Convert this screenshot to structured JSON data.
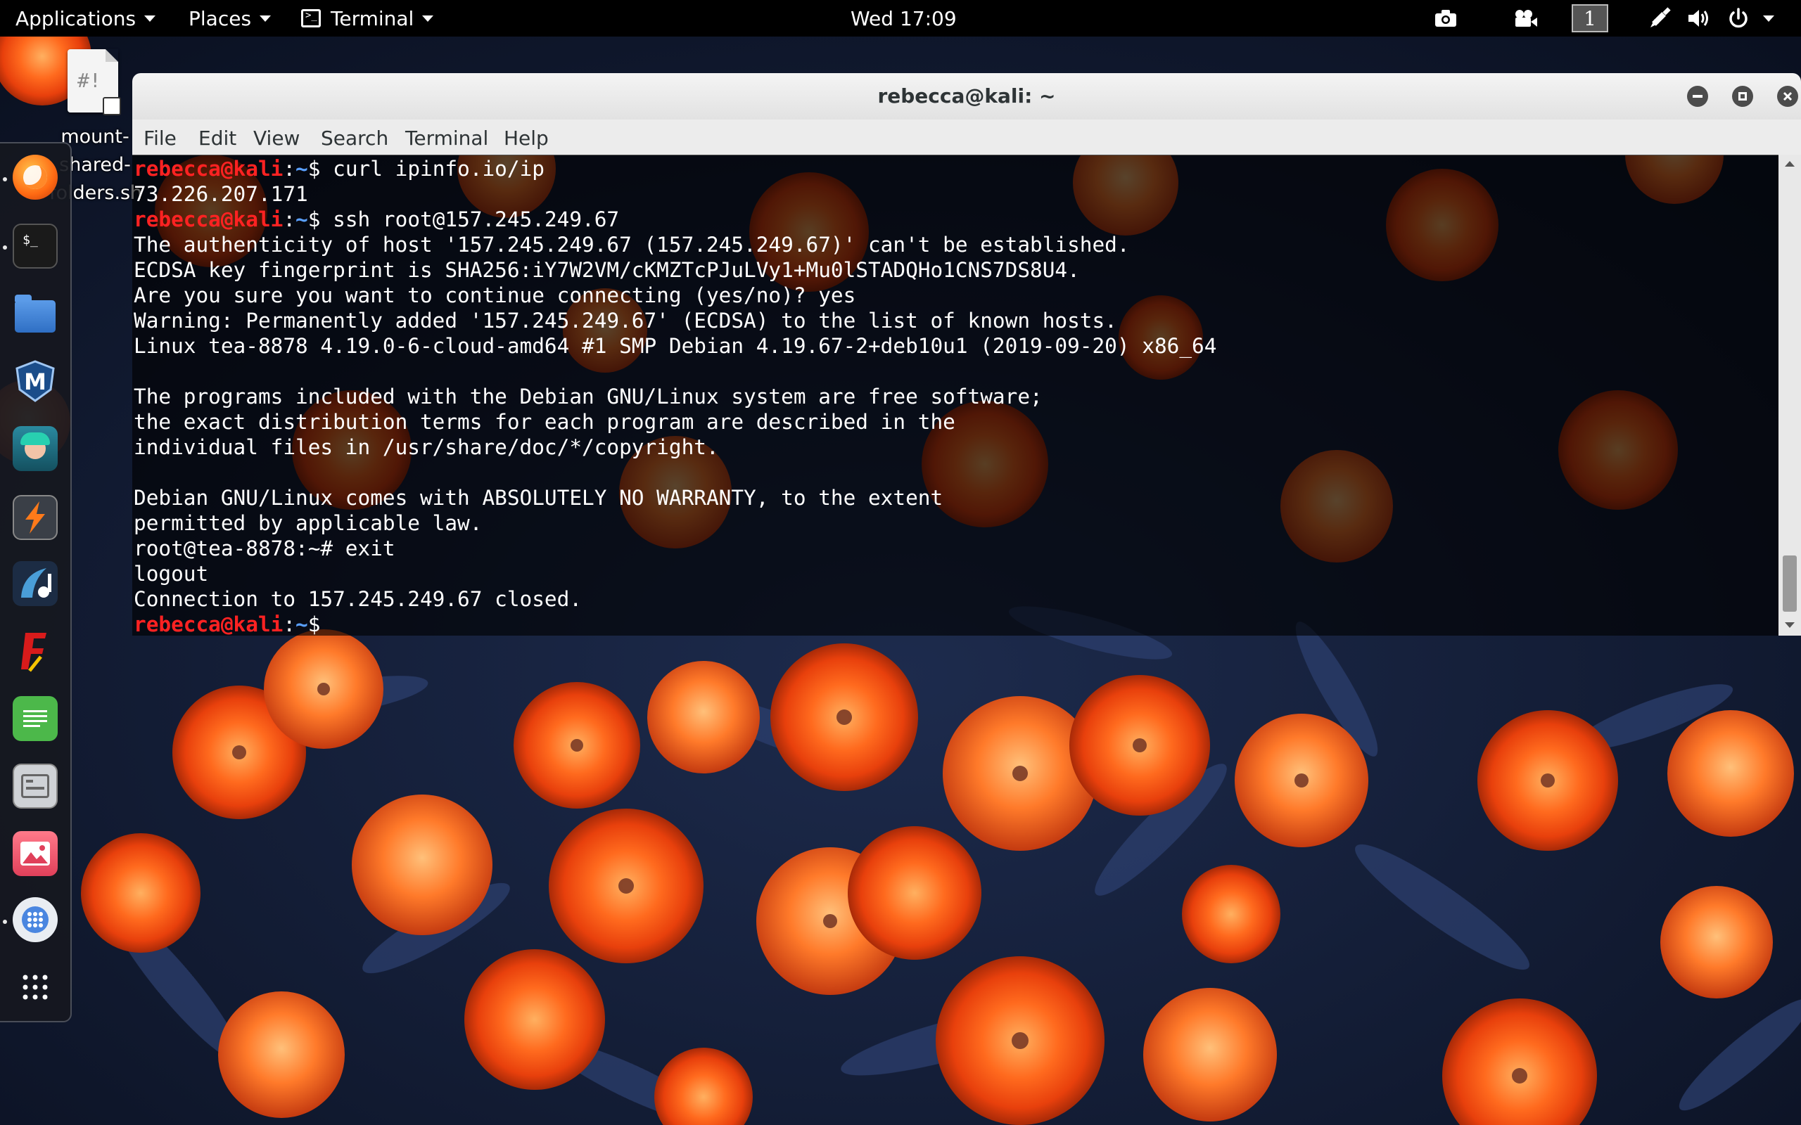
{
  "topbar": {
    "applications": "Applications",
    "places": "Places",
    "terminal_app": "Terminal",
    "clock": "Wed 17:09",
    "workspace": "1",
    "icons": [
      "camera-icon",
      "video-icon",
      "workspace-indicator",
      "pen-icon",
      "volume-icon",
      "power-icon"
    ]
  },
  "desktop": {
    "file_label": "mount-\nshared-\nfolders.sh",
    "file_icon_text": "#!"
  },
  "dock": {
    "items": [
      "firefox-icon",
      "terminal-icon",
      "files-icon",
      "metasploit-icon",
      "armitage-icon",
      "burpsuite-icon",
      "maltego-icon",
      "faraday-icon",
      "text-editor-icon",
      "settings-icon",
      "image-viewer-icon",
      "software-icon",
      "show-applications-icon"
    ]
  },
  "window": {
    "title": "rebecca@kali: ~",
    "menu": [
      "File",
      "Edit",
      "View",
      "Search",
      "Terminal",
      "Help"
    ]
  },
  "terminal": {
    "prompt_user": "rebecca@kali",
    "prompt_path": "~",
    "prompt_sym": "$",
    "lines": [
      {
        "type": "prompt",
        "cmd": " curl ipinfo.io/ip"
      },
      {
        "type": "out",
        "text": "73.226.207.171"
      },
      {
        "type": "prompt",
        "cmd": " ssh root@157.245.249.67"
      },
      {
        "type": "out",
        "text": "The authenticity of host '157.245.249.67 (157.245.249.67)' can't be established."
      },
      {
        "type": "out",
        "text": "ECDSA key fingerprint is SHA256:iY7W2VM/cKMZTcPJuLVy1+Mu0lSTADQHo1CNS7DS8U4."
      },
      {
        "type": "out",
        "text": "Are you sure you want to continue connecting (yes/no)? yes"
      },
      {
        "type": "out",
        "text": "Warning: Permanently added '157.245.249.67' (ECDSA) to the list of known hosts."
      },
      {
        "type": "out",
        "text": "Linux tea-8878 4.19.0-6-cloud-amd64 #1 SMP Debian 4.19.67-2+deb10u1 (2019-09-20) x86_64"
      },
      {
        "type": "out",
        "text": ""
      },
      {
        "type": "out",
        "text": "The programs included with the Debian GNU/Linux system are free software;"
      },
      {
        "type": "out",
        "text": "the exact distribution terms for each program are described in the"
      },
      {
        "type": "out",
        "text": "individual files in /usr/share/doc/*/copyright."
      },
      {
        "type": "out",
        "text": ""
      },
      {
        "type": "out",
        "text": "Debian GNU/Linux comes with ABSOLUTELY NO WARRANTY, to the extent"
      },
      {
        "type": "out",
        "text": "permitted by applicable law."
      },
      {
        "type": "out",
        "text": "root@tea-8878:~# exit"
      },
      {
        "type": "out",
        "text": "logout"
      },
      {
        "type": "out",
        "text": "Connection to 157.245.249.67 closed."
      },
      {
        "type": "prompt",
        "cmd": " "
      }
    ]
  },
  "colors": {
    "prompt_user": "#ff2222",
    "prompt_path": "#5aa0ff",
    "topbar_bg": "#000000"
  }
}
